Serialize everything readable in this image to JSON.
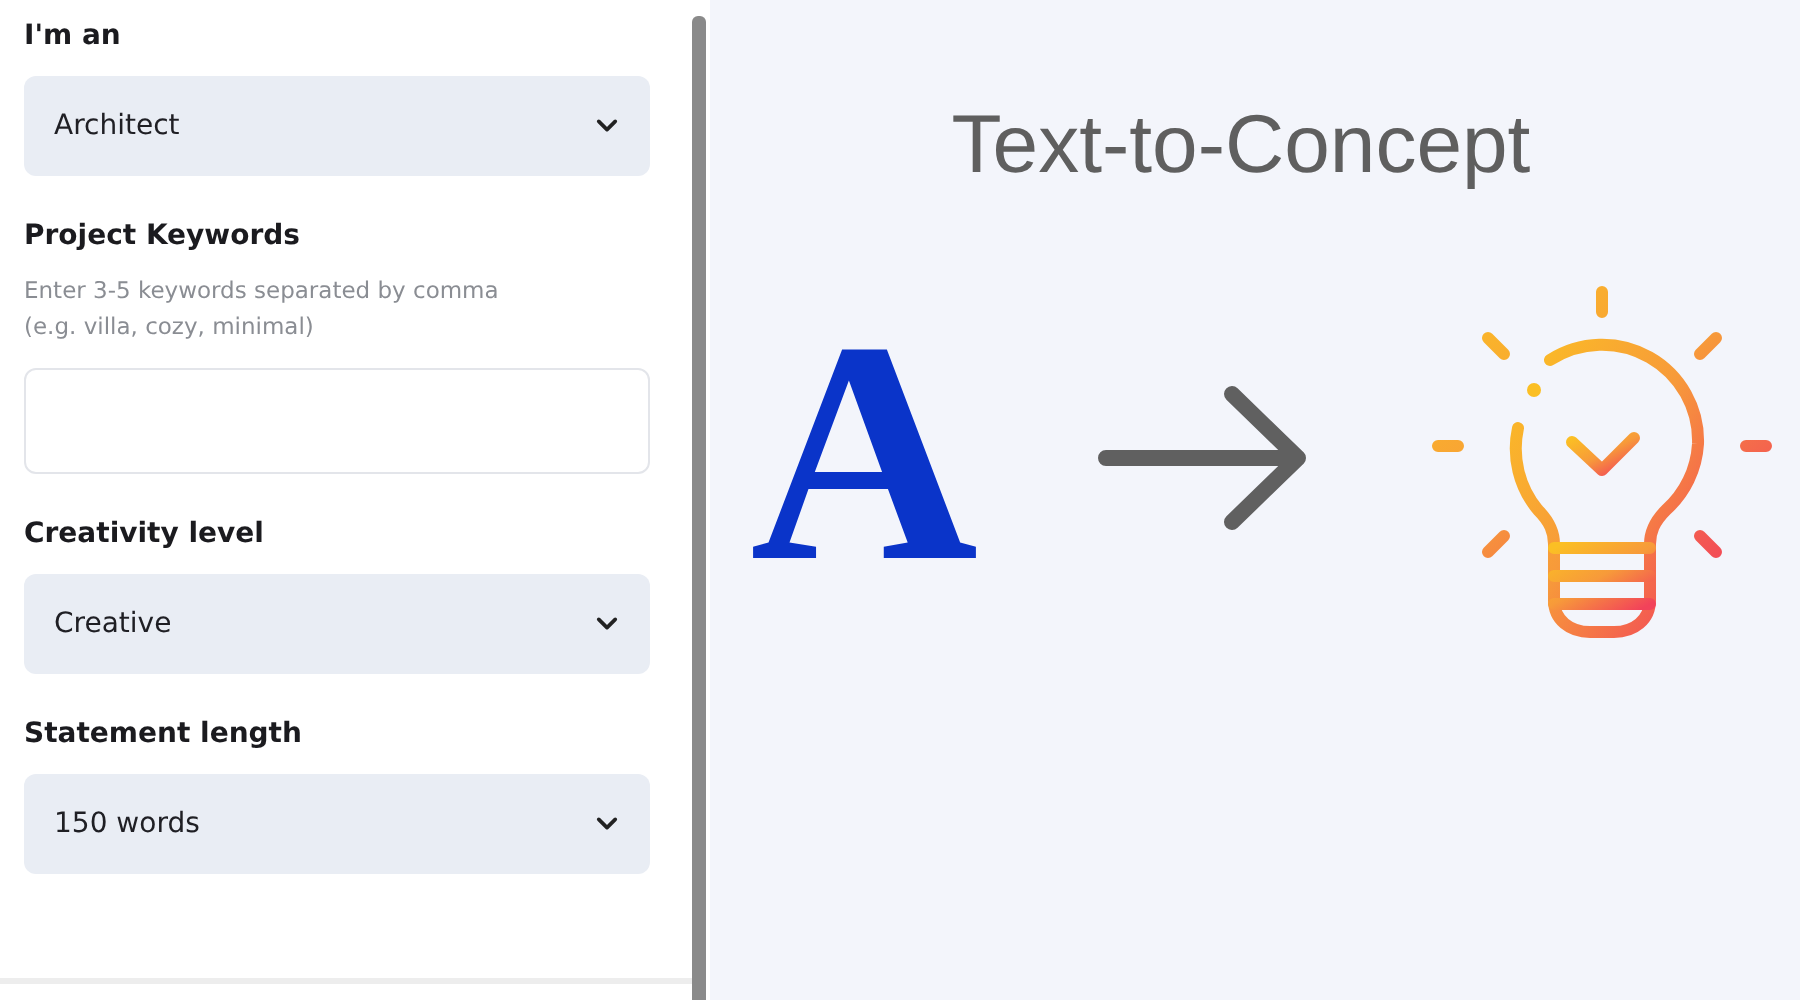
{
  "form": {
    "fields": [
      {
        "kind": "select",
        "label": "I'm an",
        "value": "Architect"
      },
      {
        "kind": "text",
        "label": "Project Keywords",
        "hint": [
          "Enter 3-5 keywords separated by comma",
          "(e.g. villa, cozy, minimal)"
        ]
      },
      {
        "kind": "select",
        "label": "Creativity level",
        "value": "Creative"
      },
      {
        "kind": "select",
        "label": "Statement length",
        "value": "150 words"
      }
    ]
  },
  "illustration": {
    "title": "Text-to-Concept",
    "letter": "A"
  }
}
